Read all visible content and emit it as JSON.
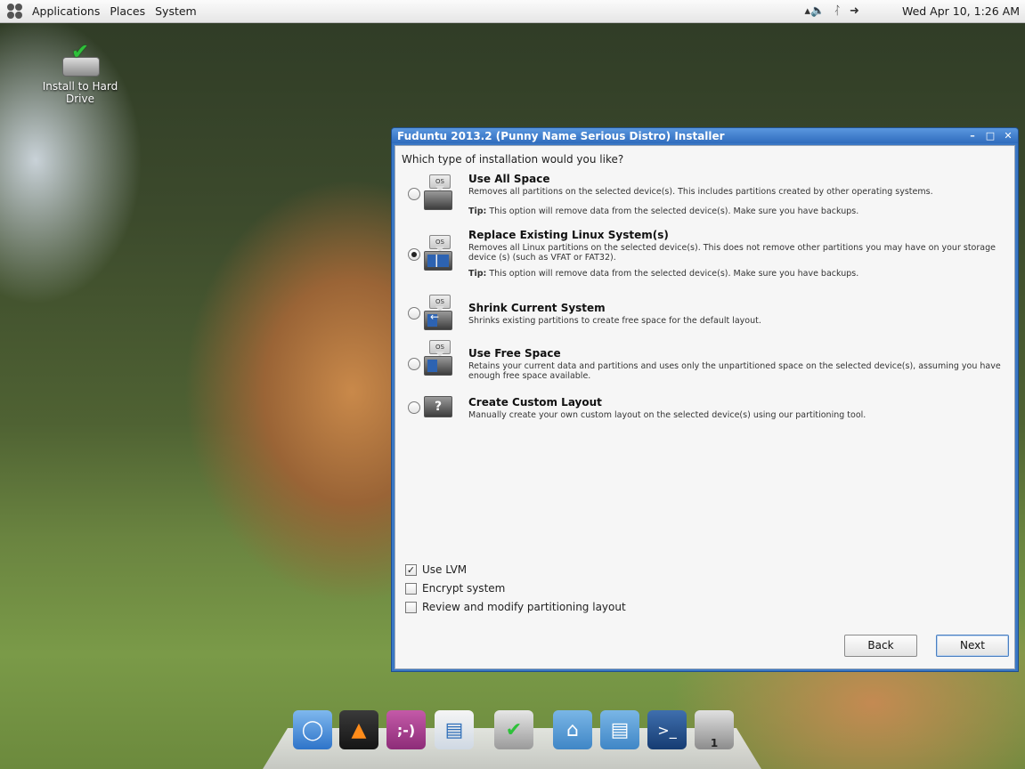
{
  "top_panel": {
    "menus": [
      "Applications",
      "Places",
      "System"
    ],
    "clock": "Wed Apr 10,  1:26 AM"
  },
  "desktop": {
    "icons": [
      {
        "label": "Install to Hard Drive"
      }
    ]
  },
  "window": {
    "title": "Fuduntu 2013.2 (Punny Name Serious Distro) Installer",
    "question": "Which type of installation would you like?",
    "options": [
      {
        "title": "Use All Space",
        "desc": "Removes all partitions on the selected device(s).  This includes partitions created by other operating systems.",
        "tip_label": "Tip:",
        "tip": "This option will remove data from the selected device(s).  Make sure you have backups.",
        "selected": false
      },
      {
        "title": "Replace Existing Linux System(s)",
        "desc": "Removes all Linux partitions on the selected device(s). This does not remove other partitions you may have on your storage device (s) (such as VFAT or FAT32).",
        "tip_label": "Tip:",
        "tip": "This option will remove data from the selected device(s).  Make sure you have backups.",
        "selected": true
      },
      {
        "title": "Shrink Current System",
        "desc": "Shrinks existing partitions to create free space for the default layout.",
        "selected": false
      },
      {
        "title": "Use Free Space",
        "desc": "Retains your current data and partitions and uses only the unpartitioned space on the selected device(s), assuming you have enough free space available.",
        "selected": false
      },
      {
        "title": "Create Custom Layout",
        "desc": "Manually create your own custom layout on the selected device(s) using our partitioning tool.",
        "selected": false
      }
    ],
    "icon_os_label": "OS",
    "icon_custom_label": "?",
    "checkboxes": [
      {
        "label": "Use LVM",
        "checked": true
      },
      {
        "label": "Encrypt system",
        "checked": false
      },
      {
        "label": "Review and modify partitioning layout",
        "checked": false
      }
    ],
    "back_label": "Back",
    "next_label": "Next"
  },
  "dock": {
    "items": [
      "chromium-icon",
      "vlc-icon",
      "pidgin-icon",
      "document-viewer-icon",
      "installer-icon",
      "home-folder-icon",
      "documents-folder-icon",
      "terminal-icon",
      "trash-icon"
    ],
    "trash_count": "1"
  }
}
